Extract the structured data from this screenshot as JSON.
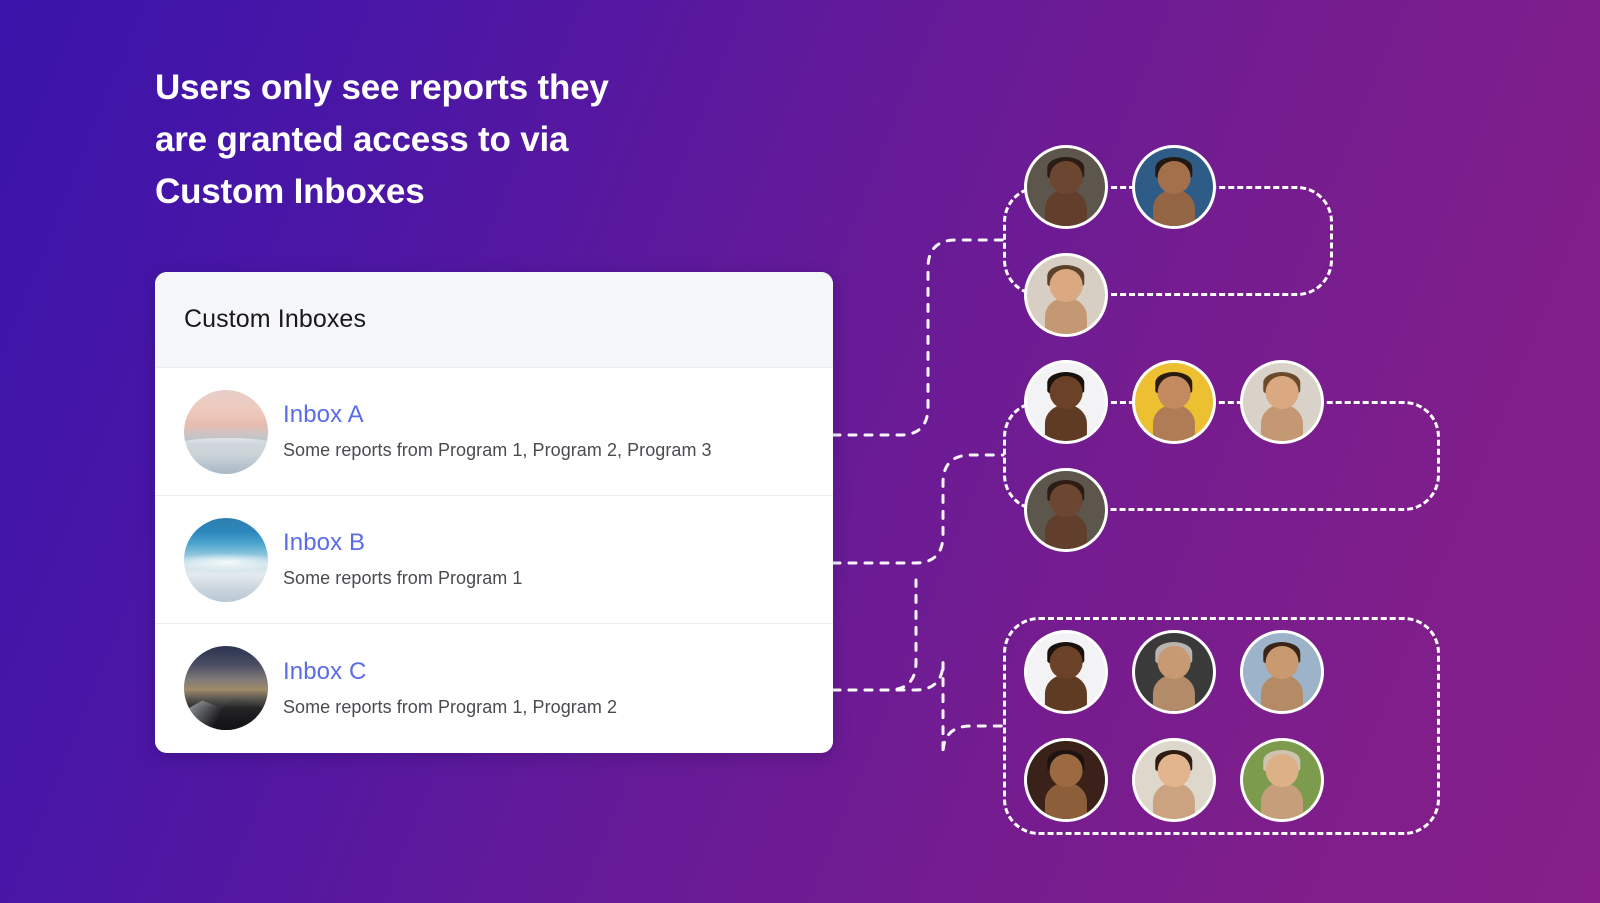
{
  "headline": {
    "lines": [
      "Users only see reports they",
      "are granted access to via",
      "Custom Inboxes"
    ]
  },
  "colors": {
    "gradient_start": "#3a14ab",
    "gradient_end": "#861f89",
    "link_blue": "#5a6ce8",
    "card_background": "#ffffff",
    "card_header_background": "#f5f6f8",
    "dashed_stroke": "#ffffff",
    "body_text": "#4a4b50",
    "title_text": "#19191d"
  },
  "card": {
    "title": "Custom Inboxes",
    "rows": [
      {
        "name": "Inbox A",
        "description": "Some reports from Program 1, Program 2, Program 3",
        "thumbnail": "sunset-over-sea-thumbnail"
      },
      {
        "name": "Inbox B",
        "description": "Some reports from Program 1",
        "thumbnail": "aerial-ocean-shore-thumbnail"
      },
      {
        "name": "Inbox C",
        "description": "Some reports from Program 1, Program 2",
        "thumbnail": "starry-night-mountain-thumbnail"
      }
    ]
  },
  "user_groups": [
    {
      "id": "group-1",
      "linked_inbox": "Inbox A",
      "count": 3,
      "avatars": [
        {
          "label": "bald-bearded-man-avatar",
          "skin": "#6d4631",
          "hair": "#2b1d16",
          "bg": "#5d564c"
        },
        {
          "label": "man-with-glasses-avatar",
          "skin": "#a3704b",
          "hair": "#241812",
          "bg": "#2f5c86"
        },
        {
          "label": "smiling-man-denim-shirt-avatar",
          "skin": "#dba981",
          "hair": "#5d4129",
          "bg": "#d8cfc4"
        }
      ]
    },
    {
      "id": "group-2",
      "linked_inbox": "Inbox B",
      "count": 4,
      "avatars": [
        {
          "label": "man-light-blue-shirt-avatar",
          "skin": "#6b4228",
          "hair": "#19110c",
          "bg": "#f3f3f5"
        },
        {
          "label": "smiling-woman-yellow-background-avatar",
          "skin": "#c48a5f",
          "hair": "#2b1a12",
          "bg": "#edc032"
        },
        {
          "label": "smiling-man-office-avatar",
          "skin": "#dba981",
          "hair": "#6b4a2b",
          "bg": "#d9d2c8"
        },
        {
          "label": "bald-bearded-man-avatar",
          "skin": "#6d4631",
          "hair": "#2b1d16",
          "bg": "#5d564c"
        }
      ]
    },
    {
      "id": "group-3",
      "linked_inbox": "Inbox C",
      "count": 6,
      "avatars": [
        {
          "label": "man-light-blue-shirt-avatar",
          "skin": "#6b4228",
          "hair": "#19110c",
          "bg": "#f3f3f5"
        },
        {
          "label": "older-man-grey-beard-avatar",
          "skin": "#c79a73",
          "hair": "#b9b4ae",
          "bg": "#3a3a3a"
        },
        {
          "label": "man-plaid-shirt-market-avatar",
          "skin": "#c99a70",
          "hair": "#3a2418",
          "bg": "#9cb3c9"
        },
        {
          "label": "man-pink-shirt-glasses-avatar",
          "skin": "#9c6a41",
          "hair": "#1d1310",
          "bg": "#3a2119"
        },
        {
          "label": "smiling-woman-dark-blazer-avatar",
          "skin": "#e2b58f",
          "hair": "#2e1c12",
          "bg": "#ded7cb"
        },
        {
          "label": "woman-in-hijab-avatar",
          "skin": "#dcb188",
          "hair": "#cfc4b2",
          "bg": "#7d9b4c"
        }
      ]
    }
  ],
  "connectors": {
    "count": 3,
    "style": "dashed-white-rounded-elbow",
    "links": [
      {
        "from": "Inbox A",
        "to": "group-1"
      },
      {
        "from": "Inbox B",
        "to": "group-2"
      },
      {
        "from": "Inbox C",
        "to": "group-3"
      }
    ]
  }
}
